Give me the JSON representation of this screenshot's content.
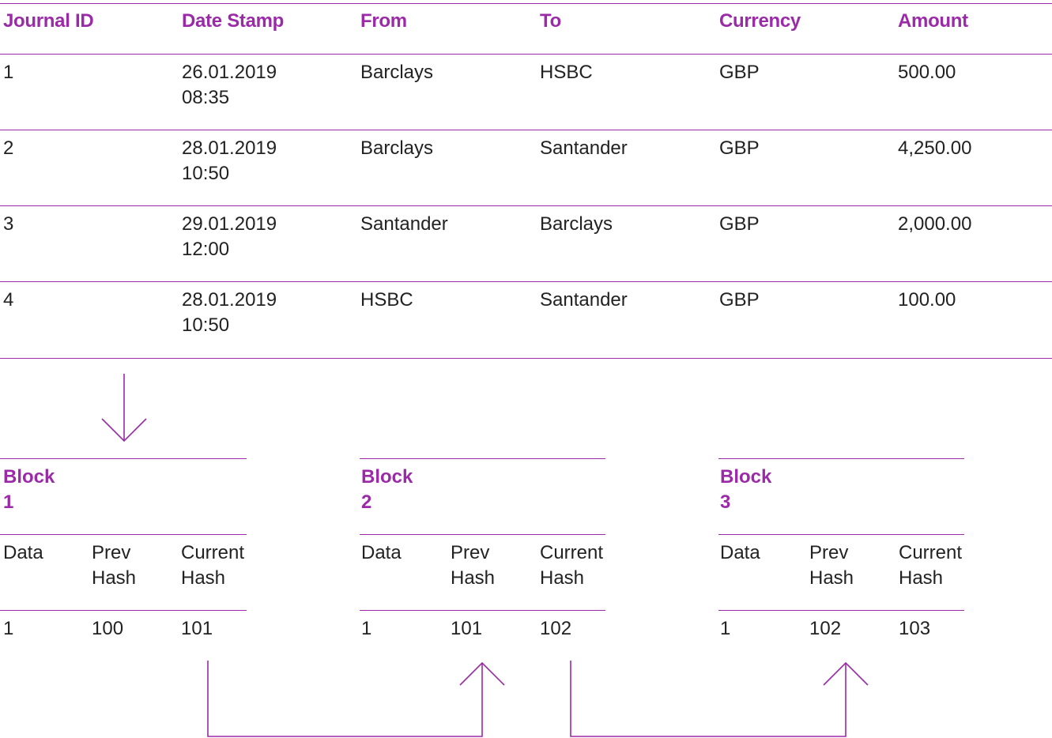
{
  "colors": {
    "accent": "#9b2aa8",
    "text": "#222222"
  },
  "journal": {
    "headers": [
      "Journal ID",
      "Date Stamp",
      "From",
      "To",
      "Currency",
      "Amount"
    ],
    "rows": [
      [
        "1",
        "26.01.2019\n08:35",
        "Barclays",
        "HSBC",
        "GBP",
        "500.00"
      ],
      [
        "2",
        "28.01.2019\n10:50",
        "Barclays",
        "Santander",
        "GBP",
        "4,250.00"
      ],
      [
        "3",
        "29.01.2019\n12:00",
        "Santander",
        "Barclays",
        "GBP",
        "2,000.00"
      ],
      [
        "4",
        "28.01.2019\n10:50",
        "HSBC",
        "Santander",
        "GBP",
        "100.00"
      ]
    ]
  },
  "blocks": [
    {
      "title": "Block\n1",
      "headers": [
        "Data",
        "Prev\nHash",
        "Current\nHash"
      ],
      "values": [
        "1",
        "100",
        "101"
      ]
    },
    {
      "title": "Block\n2",
      "headers": [
        "Data",
        "Prev\nHash",
        "Current\nHash"
      ],
      "values": [
        "1",
        "101",
        "102"
      ]
    },
    {
      "title": "Block\n3",
      "headers": [
        "Data",
        "Prev\nHash",
        "Current\nHash"
      ],
      "values": [
        "1",
        "102",
        "103"
      ]
    }
  ],
  "icons": {
    "down": "arrow-down-icon",
    "up": "arrow-up-icon"
  }
}
